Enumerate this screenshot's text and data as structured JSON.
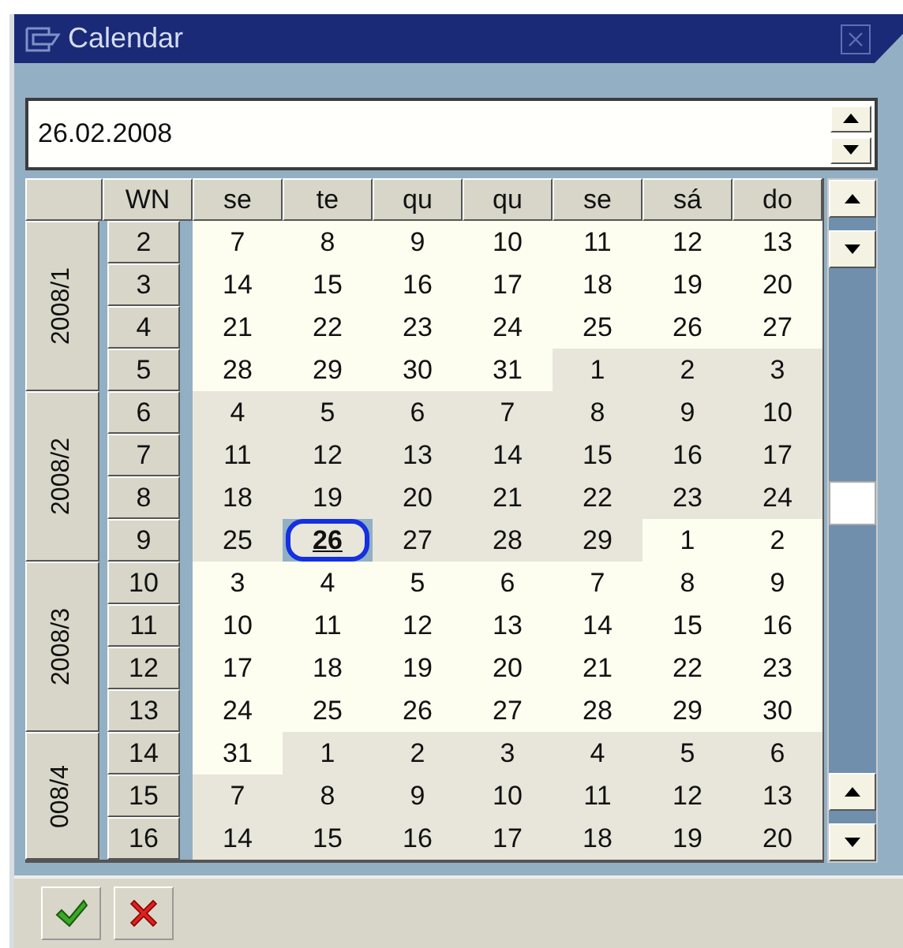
{
  "window": {
    "title": "Calendar"
  },
  "date_field": {
    "value": "26.02.2008"
  },
  "columns": [
    "WN",
    "se",
    "te",
    "qu",
    "qu",
    "se",
    "sá",
    "do"
  ],
  "groups": [
    {
      "label": "2008/1",
      "weeks": [
        {
          "wn": "2",
          "days": [
            {
              "text": "7",
              "shaded": false,
              "selected": false
            },
            {
              "text": "8",
              "shaded": false,
              "selected": false
            },
            {
              "text": "9",
              "shaded": false,
              "selected": false
            },
            {
              "text": "10",
              "shaded": false,
              "selected": false
            },
            {
              "text": "11",
              "shaded": false,
              "selected": false
            },
            {
              "text": "12",
              "shaded": false,
              "selected": false
            },
            {
              "text": "13",
              "shaded": false,
              "selected": false
            }
          ]
        },
        {
          "wn": "3",
          "days": [
            {
              "text": "14",
              "shaded": false,
              "selected": false
            },
            {
              "text": "15",
              "shaded": false,
              "selected": false
            },
            {
              "text": "16",
              "shaded": false,
              "selected": false
            },
            {
              "text": "17",
              "shaded": false,
              "selected": false
            },
            {
              "text": "18",
              "shaded": false,
              "selected": false
            },
            {
              "text": "19",
              "shaded": false,
              "selected": false
            },
            {
              "text": "20",
              "shaded": false,
              "selected": false
            }
          ]
        },
        {
          "wn": "4",
          "days": [
            {
              "text": "21",
              "shaded": false,
              "selected": false
            },
            {
              "text": "22",
              "shaded": false,
              "selected": false
            },
            {
              "text": "23",
              "shaded": false,
              "selected": false
            },
            {
              "text": "24",
              "shaded": false,
              "selected": false
            },
            {
              "text": "25",
              "shaded": false,
              "selected": false
            },
            {
              "text": "26",
              "shaded": false,
              "selected": false
            },
            {
              "text": "27",
              "shaded": false,
              "selected": false
            }
          ]
        },
        {
          "wn": "5",
          "days": [
            {
              "text": "28",
              "shaded": false,
              "selected": false
            },
            {
              "text": "29",
              "shaded": false,
              "selected": false
            },
            {
              "text": "30",
              "shaded": false,
              "selected": false
            },
            {
              "text": "31",
              "shaded": false,
              "selected": false
            },
            {
              "text": "1",
              "shaded": true,
              "selected": false
            },
            {
              "text": "2",
              "shaded": true,
              "selected": false
            },
            {
              "text": "3",
              "shaded": true,
              "selected": false
            }
          ]
        }
      ]
    },
    {
      "label": "2008/2",
      "weeks": [
        {
          "wn": "6",
          "days": [
            {
              "text": "4",
              "shaded": true,
              "selected": false
            },
            {
              "text": "5",
              "shaded": true,
              "selected": false
            },
            {
              "text": "6",
              "shaded": true,
              "selected": false
            },
            {
              "text": "7",
              "shaded": true,
              "selected": false
            },
            {
              "text": "8",
              "shaded": true,
              "selected": false
            },
            {
              "text": "9",
              "shaded": true,
              "selected": false
            },
            {
              "text": "10",
              "shaded": true,
              "selected": false
            }
          ]
        },
        {
          "wn": "7",
          "days": [
            {
              "text": "11",
              "shaded": true,
              "selected": false
            },
            {
              "text": "12",
              "shaded": true,
              "selected": false
            },
            {
              "text": "13",
              "shaded": true,
              "selected": false
            },
            {
              "text": "14",
              "shaded": true,
              "selected": false
            },
            {
              "text": "15",
              "shaded": true,
              "selected": false
            },
            {
              "text": "16",
              "shaded": true,
              "selected": false
            },
            {
              "text": "17",
              "shaded": true,
              "selected": false
            }
          ]
        },
        {
          "wn": "8",
          "days": [
            {
              "text": "18",
              "shaded": true,
              "selected": false
            },
            {
              "text": "19",
              "shaded": true,
              "selected": false
            },
            {
              "text": "20",
              "shaded": true,
              "selected": false
            },
            {
              "text": "21",
              "shaded": true,
              "selected": false
            },
            {
              "text": "22",
              "shaded": true,
              "selected": false
            },
            {
              "text": "23",
              "shaded": true,
              "selected": false
            },
            {
              "text": "24",
              "shaded": true,
              "selected": false
            }
          ]
        },
        {
          "wn": "9",
          "days": [
            {
              "text": "25",
              "shaded": true,
              "selected": false
            },
            {
              "text": "26",
              "shaded": true,
              "selected": true
            },
            {
              "text": "27",
              "shaded": true,
              "selected": false
            },
            {
              "text": "28",
              "shaded": true,
              "selected": false
            },
            {
              "text": "29",
              "shaded": true,
              "selected": false
            },
            {
              "text": "1",
              "shaded": false,
              "selected": false
            },
            {
              "text": "2",
              "shaded": false,
              "selected": false
            }
          ]
        }
      ]
    },
    {
      "label": "2008/3",
      "weeks": [
        {
          "wn": "10",
          "days": [
            {
              "text": "3",
              "shaded": false,
              "selected": false
            },
            {
              "text": "4",
              "shaded": false,
              "selected": false
            },
            {
              "text": "5",
              "shaded": false,
              "selected": false
            },
            {
              "text": "6",
              "shaded": false,
              "selected": false
            },
            {
              "text": "7",
              "shaded": false,
              "selected": false
            },
            {
              "text": "8",
              "shaded": false,
              "selected": false
            },
            {
              "text": "9",
              "shaded": false,
              "selected": false
            }
          ]
        },
        {
          "wn": "11",
          "days": [
            {
              "text": "10",
              "shaded": false,
              "selected": false
            },
            {
              "text": "11",
              "shaded": false,
              "selected": false
            },
            {
              "text": "12",
              "shaded": false,
              "selected": false
            },
            {
              "text": "13",
              "shaded": false,
              "selected": false
            },
            {
              "text": "14",
              "shaded": false,
              "selected": false
            },
            {
              "text": "15",
              "shaded": false,
              "selected": false
            },
            {
              "text": "16",
              "shaded": false,
              "selected": false
            }
          ]
        },
        {
          "wn": "12",
          "days": [
            {
              "text": "17",
              "shaded": false,
              "selected": false
            },
            {
              "text": "18",
              "shaded": false,
              "selected": false
            },
            {
              "text": "19",
              "shaded": false,
              "selected": false
            },
            {
              "text": "20",
              "shaded": false,
              "selected": false
            },
            {
              "text": "21",
              "shaded": false,
              "selected": false
            },
            {
              "text": "22",
              "shaded": false,
              "selected": false
            },
            {
              "text": "23",
              "shaded": false,
              "selected": false
            }
          ]
        },
        {
          "wn": "13",
          "days": [
            {
              "text": "24",
              "shaded": false,
              "selected": false
            },
            {
              "text": "25",
              "shaded": false,
              "selected": false
            },
            {
              "text": "26",
              "shaded": false,
              "selected": false
            },
            {
              "text": "27",
              "shaded": false,
              "selected": false
            },
            {
              "text": "28",
              "shaded": false,
              "selected": false
            },
            {
              "text": "29",
              "shaded": false,
              "selected": false
            },
            {
              "text": "30",
              "shaded": false,
              "selected": false
            }
          ]
        }
      ]
    },
    {
      "label": "008/4",
      "weeks": [
        {
          "wn": "14",
          "days": [
            {
              "text": "31",
              "shaded": false,
              "selected": false
            },
            {
              "text": "1",
              "shaded": true,
              "selected": false
            },
            {
              "text": "2",
              "shaded": true,
              "selected": false
            },
            {
              "text": "3",
              "shaded": true,
              "selected": false
            },
            {
              "text": "4",
              "shaded": true,
              "selected": false
            },
            {
              "text": "5",
              "shaded": true,
              "selected": false
            },
            {
              "text": "6",
              "shaded": true,
              "selected": false
            }
          ]
        },
        {
          "wn": "15",
          "days": [
            {
              "text": "7",
              "shaded": true,
              "selected": false
            },
            {
              "text": "8",
              "shaded": true,
              "selected": false
            },
            {
              "text": "9",
              "shaded": true,
              "selected": false
            },
            {
              "text": "10",
              "shaded": true,
              "selected": false
            },
            {
              "text": "11",
              "shaded": true,
              "selected": false
            },
            {
              "text": "12",
              "shaded": true,
              "selected": false
            },
            {
              "text": "13",
              "shaded": true,
              "selected": false
            }
          ]
        },
        {
          "wn": "16",
          "days": [
            {
              "text": "14",
              "shaded": true,
              "selected": false
            },
            {
              "text": "15",
              "shaded": true,
              "selected": false
            },
            {
              "text": "16",
              "shaded": true,
              "selected": false
            },
            {
              "text": "17",
              "shaded": true,
              "selected": false
            },
            {
              "text": "18",
              "shaded": true,
              "selected": false
            },
            {
              "text": "19",
              "shaded": true,
              "selected": false
            },
            {
              "text": "20",
              "shaded": true,
              "selected": false
            }
          ]
        }
      ]
    }
  ]
}
